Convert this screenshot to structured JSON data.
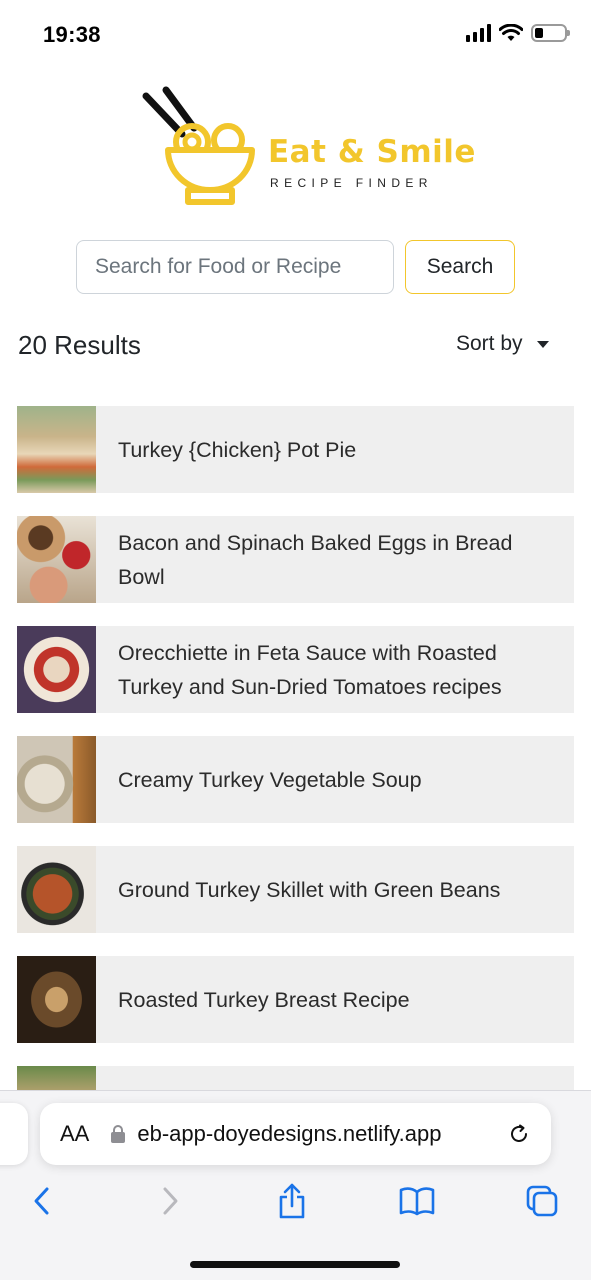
{
  "status_bar": {
    "time": "19:38"
  },
  "logo": {
    "title": "Eat & Smile",
    "subtitle": "RECIPE FINDER",
    "brand_color": "#f2c62c"
  },
  "search": {
    "placeholder": "Search for Food or Recipe",
    "value": "",
    "button_label": "Search"
  },
  "results": {
    "count_label": "20 Results",
    "sort_label": "Sort by",
    "items": [
      {
        "title": "Turkey {Chicken} Pot Pie",
        "thumb_color": "#b9a37a"
      },
      {
        "title": "Bacon and Spinach Baked Eggs in Bread Bowl",
        "thumb_color": "#c98b6a"
      },
      {
        "title": "Orecchiette in Feta Sauce with Roasted Turkey and Sun-Dried Tomatoes recipes",
        "thumb_color": "#a86a55"
      },
      {
        "title": "Creamy Turkey Vegetable Soup",
        "thumb_color": "#b7ad9a"
      },
      {
        "title": "Ground Turkey Skillet with Green Beans",
        "thumb_color": "#7b5a3a"
      },
      {
        "title": "Roasted Turkey Breast Recipe",
        "thumb_color": "#6a4a2e"
      },
      {
        "title": "",
        "thumb_color": "#8a7a5a"
      }
    ]
  },
  "browser": {
    "text_size_label": "AA",
    "url": "eb-app-doyedesigns.netlify.app",
    "icons": [
      "back-icon",
      "forward-icon",
      "share-icon",
      "bookmarks-icon",
      "tabs-icon",
      "reload-icon",
      "lock-icon"
    ]
  }
}
